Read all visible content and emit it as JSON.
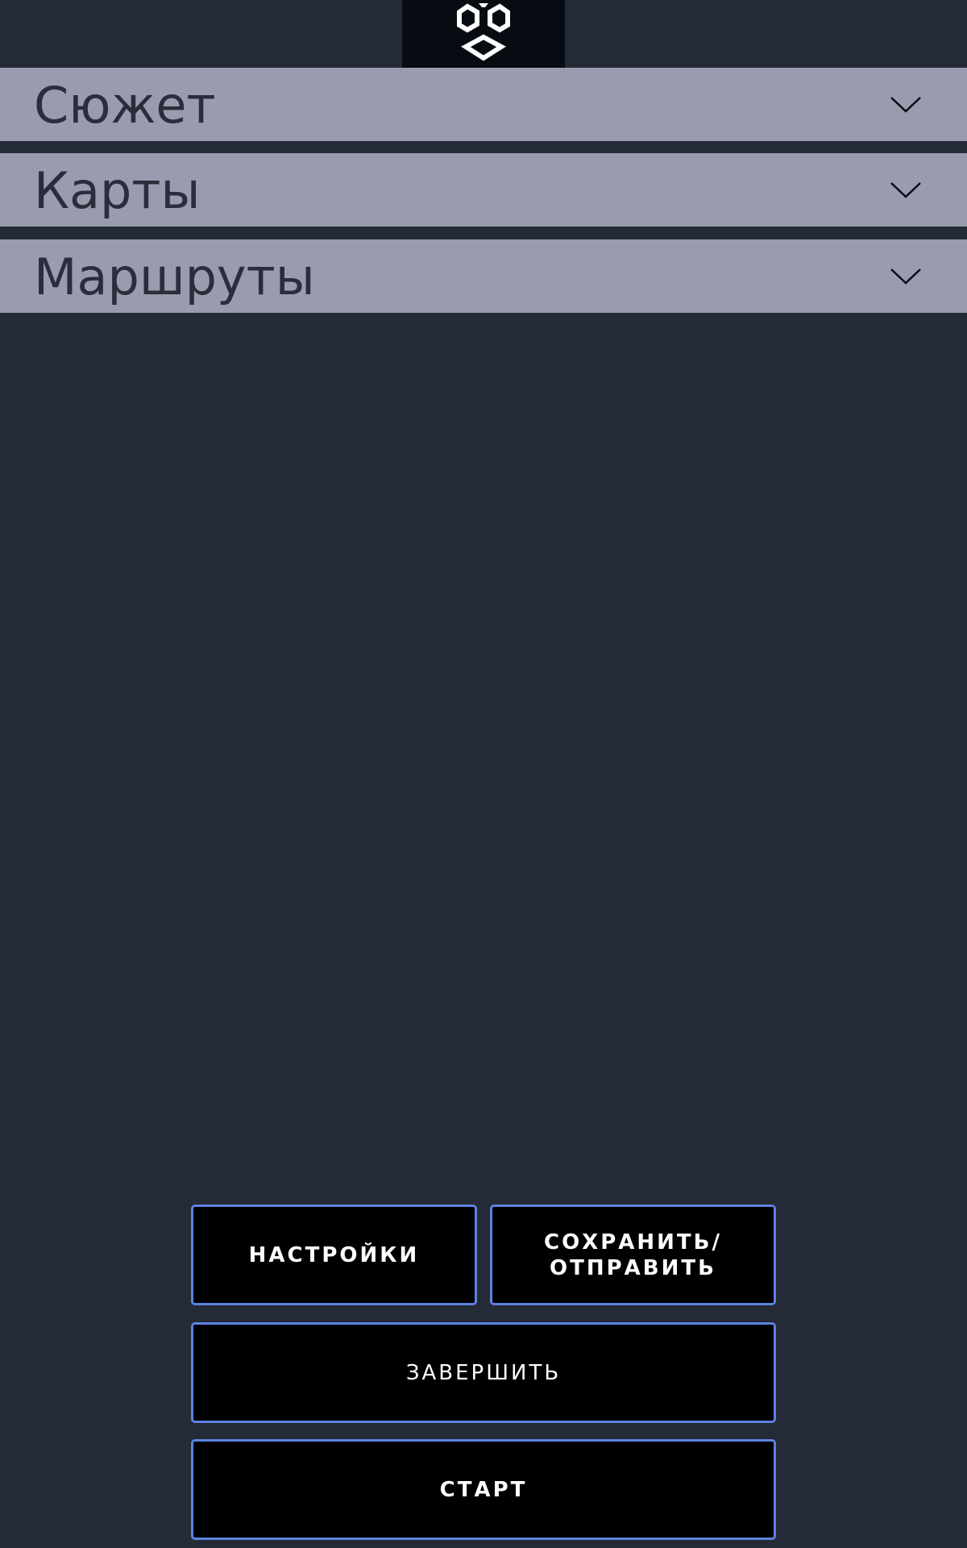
{
  "logo": {
    "icon": "hexagon-cube-logo-icon"
  },
  "accordions": [
    {
      "label": "Сюжет",
      "icon": "chevron-down-icon"
    },
    {
      "label": "Карты",
      "icon": "chevron-down-icon"
    },
    {
      "label": "Маршруты",
      "icon": "chevron-down-icon"
    }
  ],
  "buttons": {
    "settings": "НАСТРОЙКИ",
    "save_send": "СОХРАНИТЬ/\nОТПРАВИТЬ",
    "finish": "ЗАВЕРШИТЬ",
    "start": "СТАРТ"
  },
  "colors": {
    "background": "#252a37",
    "accordion_bg": "#989cae",
    "accordion_text": "#2a2e3b",
    "logo_bg": "#070b12",
    "button_bg": "#000000",
    "button_border": "#5b83e0",
    "button_text": "#ffffff"
  }
}
